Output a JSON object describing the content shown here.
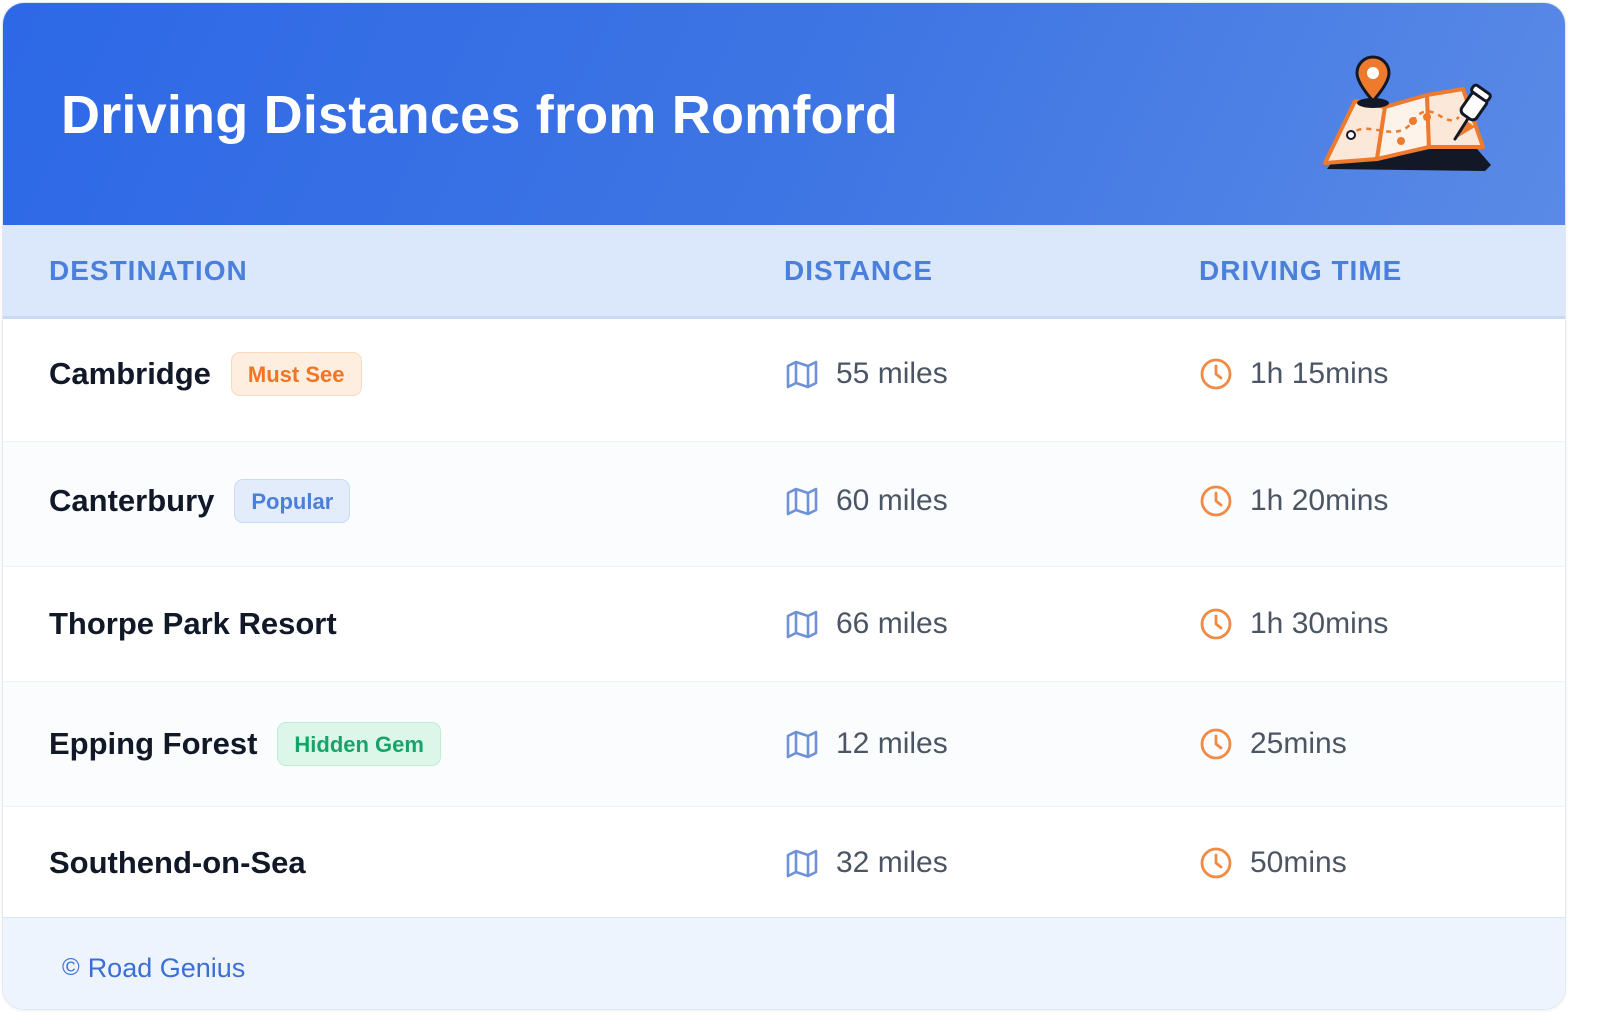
{
  "header": {
    "title": "Driving Distances from Romford",
    "illustration": "map-with-pins-icon"
  },
  "columns": {
    "destination": "DESTINATION",
    "distance": "DISTANCE",
    "driving_time": "DRIVING TIME"
  },
  "rows": [
    {
      "destination": "Cambridge",
      "badge": {
        "label": "Must See",
        "text_color": "#f27424",
        "bg_color": "#fdeedf",
        "border_color": "#fbd9bb"
      },
      "distance": "55 miles",
      "time": "1h 15mins"
    },
    {
      "destination": "Canterbury",
      "badge": {
        "label": "Popular",
        "text_color": "#4a7fdc",
        "bg_color": "#e2ecfb",
        "border_color": "#c8daf6"
      },
      "distance": "60 miles",
      "time": "1h 20mins"
    },
    {
      "destination": "Thorpe Park Resort",
      "badge": null,
      "distance": "66 miles",
      "time": "1h 30mins"
    },
    {
      "destination": "Epping Forest",
      "badge": {
        "label": "Hidden Gem",
        "text_color": "#18a468",
        "bg_color": "#dcf7e9",
        "border_color": "#c0ecd5"
      },
      "distance": "12 miles",
      "time": "25mins"
    },
    {
      "destination": "Southend-on-Sea",
      "badge": null,
      "distance": "32 miles",
      "time": "50mins"
    }
  ],
  "icons": {
    "distance": "map-icon",
    "time": "clock-icon"
  },
  "colors": {
    "accent_blue": "#2d68e6",
    "header_text": "#4a7fdc",
    "orange": "#f08a45",
    "map_icon": "#6f92d6"
  },
  "footer": {
    "symbol": "©",
    "brand": "Road Genius"
  }
}
